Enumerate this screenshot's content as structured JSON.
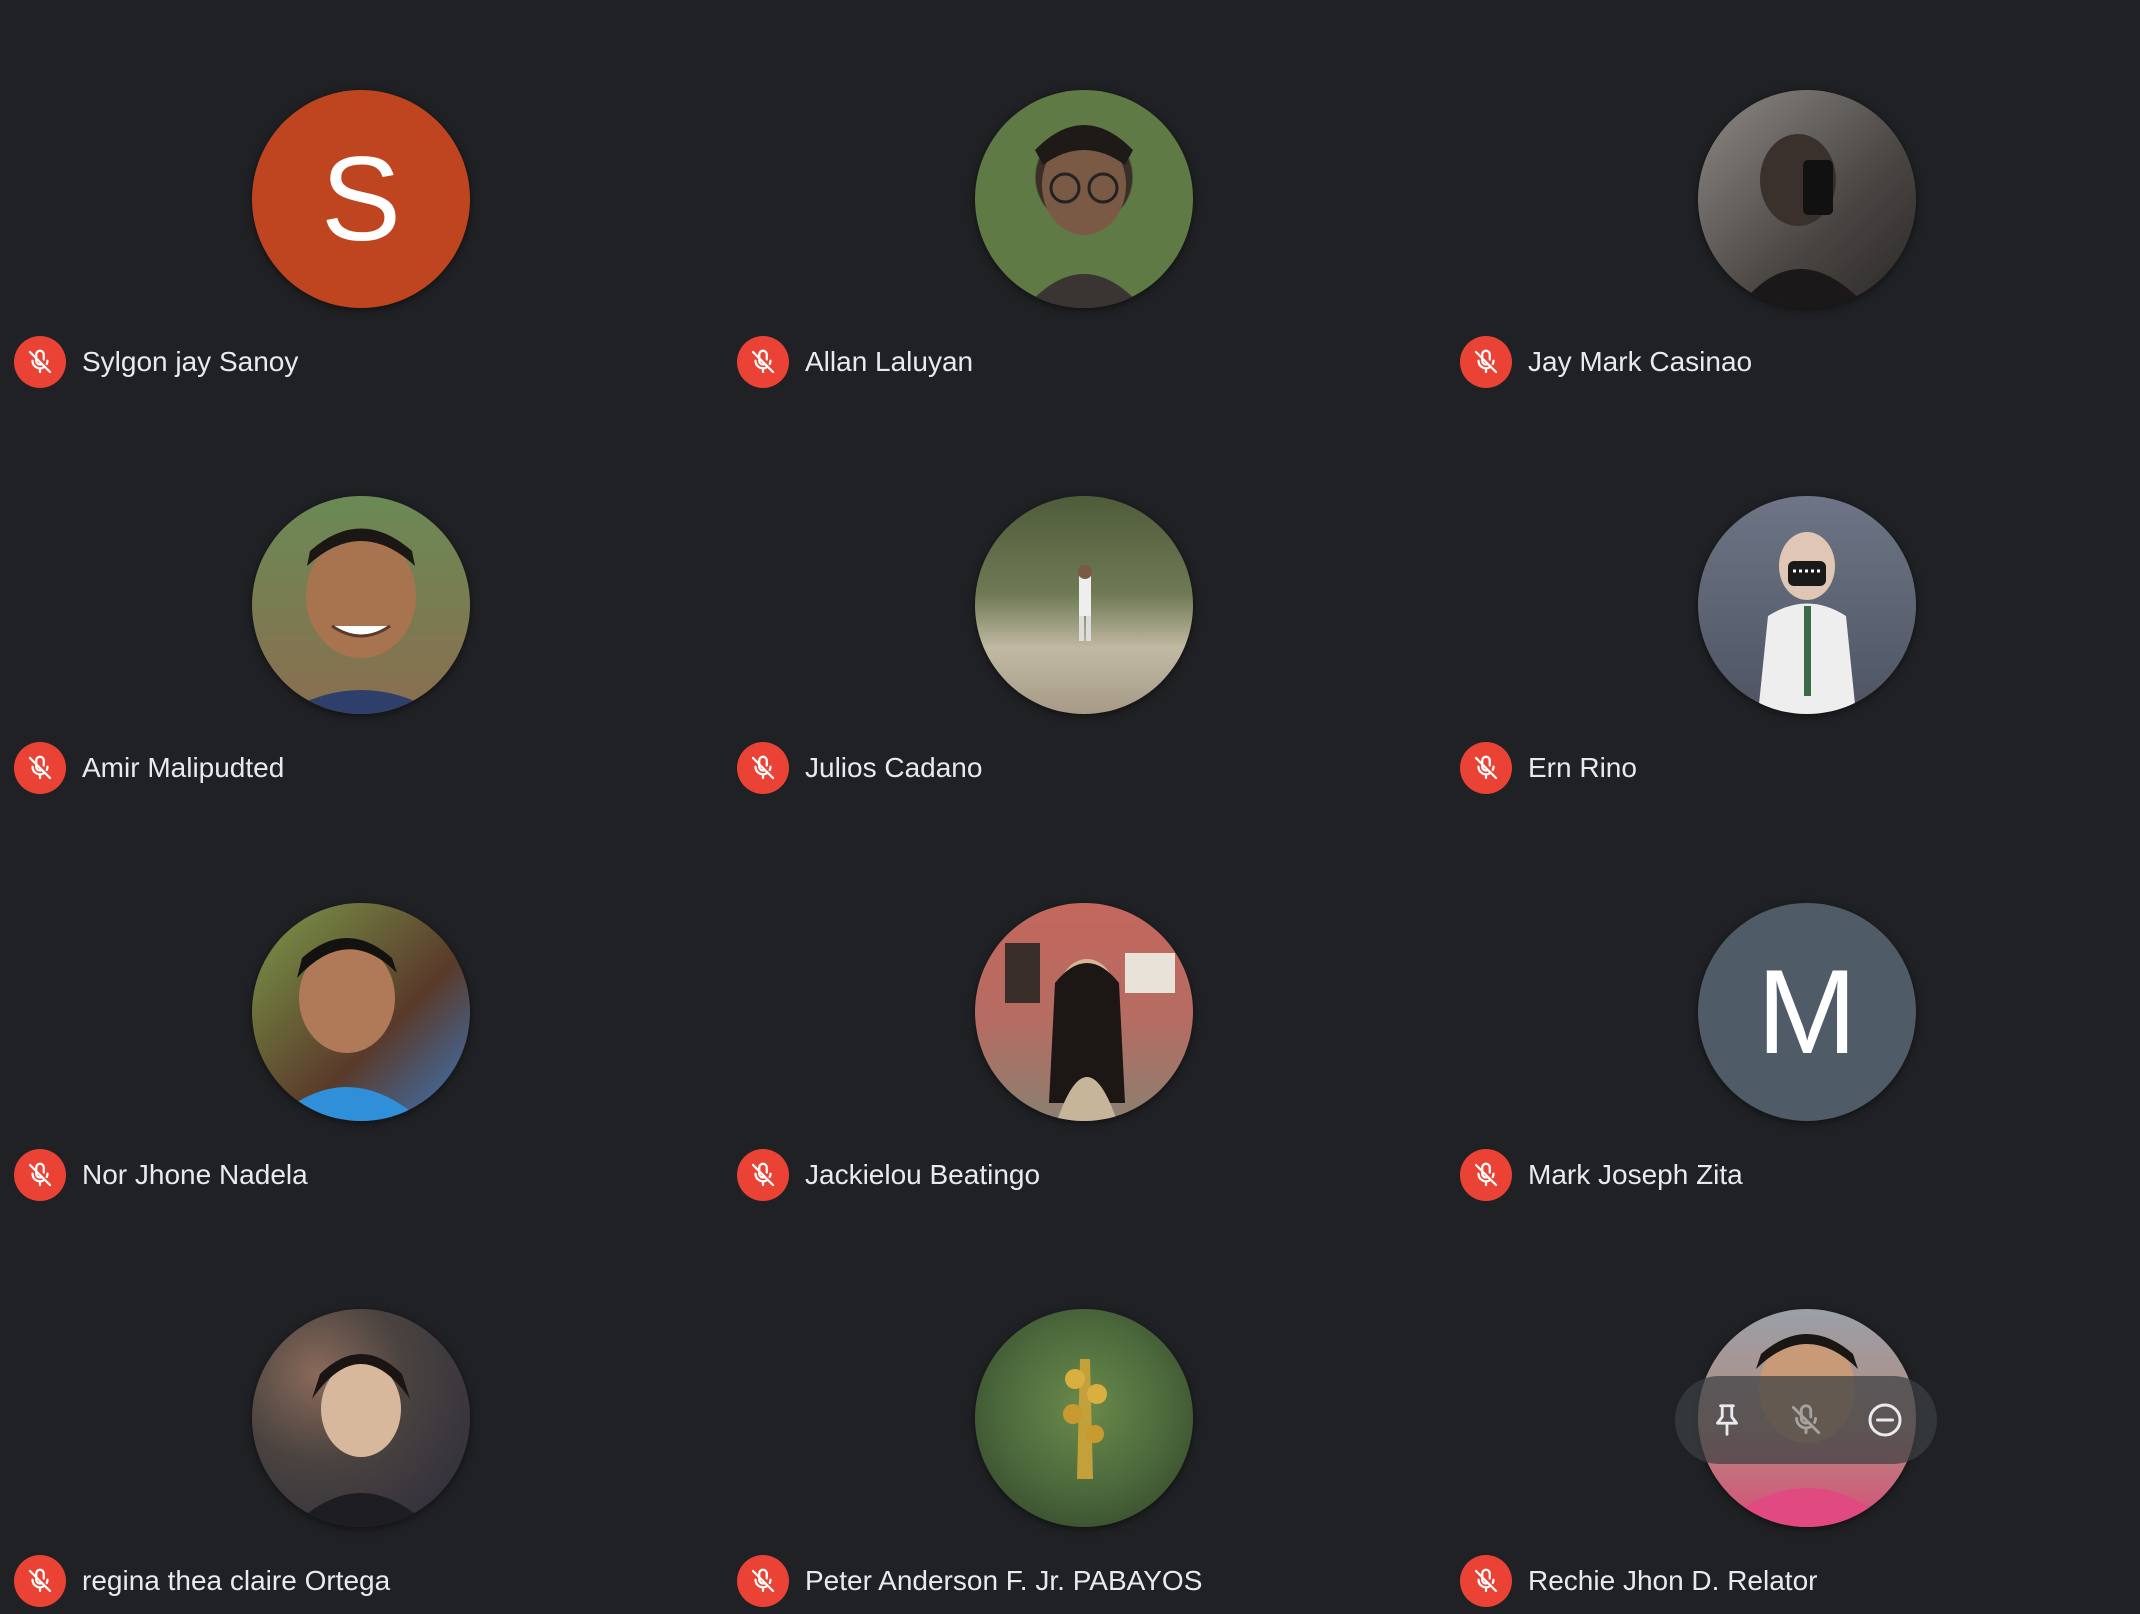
{
  "participants": [
    {
      "name": "Sylgon jay Sanoy",
      "avatar_type": "initial",
      "initial": "S",
      "avatar_color": "#bf4520",
      "muted": true
    },
    {
      "name": "Allan Laluyan",
      "avatar_type": "photo",
      "photo_tone": "#5f7a45",
      "muted": true
    },
    {
      "name": "Jay Mark Casinao",
      "avatar_type": "photo",
      "photo_tone": "#6e6a66",
      "muted": true
    },
    {
      "name": "Amir Malipudted",
      "avatar_type": "photo",
      "photo_tone": "#8a6e4f",
      "muted": true
    },
    {
      "name": "Julios Cadano",
      "avatar_type": "photo",
      "photo_tone": "#7d8366",
      "muted": true
    },
    {
      "name": "Ern Rino",
      "avatar_type": "photo",
      "photo_tone": "#6a7182",
      "muted": true
    },
    {
      "name": "Nor Jhone Nadela",
      "avatar_type": "photo",
      "photo_tone": "#6f7a4e",
      "muted": true
    },
    {
      "name": "Jackielou Beatingo",
      "avatar_type": "photo",
      "photo_tone": "#b56c62",
      "muted": true
    },
    {
      "name": "Mark Joseph Zita",
      "avatar_type": "initial",
      "initial": "M",
      "avatar_color": "#4f5b66",
      "muted": true
    },
    {
      "name": "regina thea claire Ortega",
      "avatar_type": "photo",
      "photo_tone": "#4a4340",
      "muted": true
    },
    {
      "name": "Peter Anderson F. Jr. PABAYOS",
      "avatar_type": "photo",
      "photo_tone": "#4d6a3d",
      "muted": true
    },
    {
      "name": "Rechie Jhon D. Relator",
      "avatar_type": "photo",
      "photo_tone": "#b5707e",
      "muted": true
    }
  ],
  "hover_controls": {
    "participant": "Rechie Jhon D. Relator",
    "buttons": [
      "pin-icon",
      "mic-off-icon",
      "remove-icon"
    ]
  },
  "colors": {
    "background": "#202124",
    "muted_badge": "#ea4335",
    "name_text": "#e8eaed"
  }
}
